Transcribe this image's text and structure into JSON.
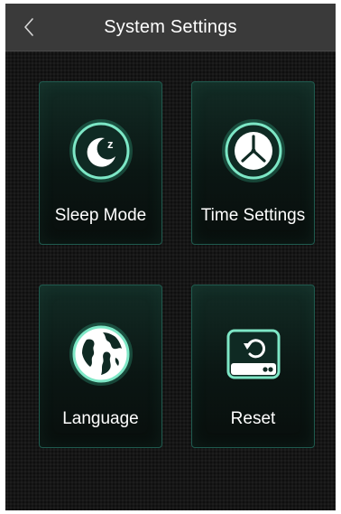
{
  "header": {
    "back_icon": "chevron-left-icon",
    "title": "System Settings"
  },
  "tiles": [
    {
      "label": "Sleep Mode",
      "icon": "moon-sleep-icon"
    },
    {
      "label": "Time Settings",
      "icon": "clock-icon"
    },
    {
      "label": "Language",
      "icon": "globe-icon"
    },
    {
      "label": "Reset",
      "icon": "reset-device-icon"
    }
  ],
  "colors": {
    "accent": "#3fd7a6",
    "header_bg": "#3a3a3a",
    "screen_bg": "#161616",
    "tile_border": "#1f5a4e"
  }
}
